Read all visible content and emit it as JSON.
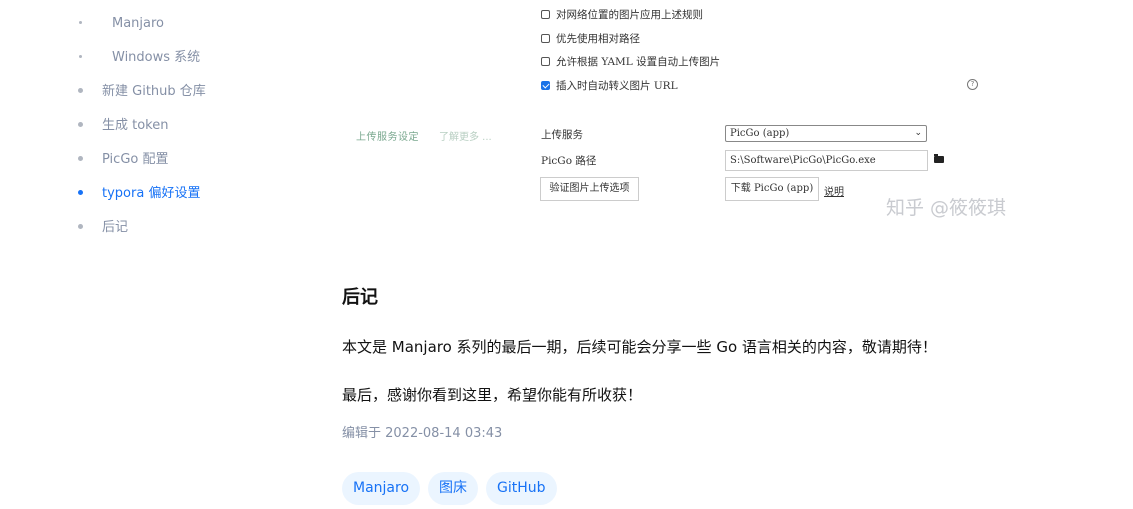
{
  "toc": {
    "items": [
      {
        "label": "Manjaro",
        "level": "sub",
        "active": false
      },
      {
        "label": "Windows 系统",
        "level": "sub",
        "active": false
      },
      {
        "label": "新建 Github 仓库",
        "level": "main",
        "active": false
      },
      {
        "label": "生成 token",
        "level": "main",
        "active": false
      },
      {
        "label": "PicGo 配置",
        "level": "main",
        "active": false
      },
      {
        "label": "typora 偏好设置",
        "level": "main",
        "active": true
      },
      {
        "label": "后记",
        "level": "main",
        "active": false
      }
    ]
  },
  "settings_shot": {
    "checkboxes": [
      {
        "label": "对网络位置的图片应用上述规则",
        "checked": false
      },
      {
        "label": "优先使用相对路径",
        "checked": false
      },
      {
        "label": "允许根据 YAML 设置自动上传图片",
        "checked": false
      },
      {
        "label": "插入时自动转义图片 URL",
        "checked": true
      }
    ],
    "help_icon": "?",
    "upload_section_title": "上传服务设定",
    "learn_more": "了解更多 ...",
    "upload_service_label": "上传服务",
    "upload_service_value": "PicGo (app)",
    "picgo_path_label": "PicGo 路径",
    "picgo_path_value": "S:\\Software\\PicGo\\PicGo.exe",
    "verify_button": "验证图片上传选项",
    "download_button": "下载 PicGo (app)",
    "explain_link": "说明",
    "watermark": "知乎 @筱筱琪"
  },
  "article": {
    "heading": "后记",
    "paragraph1": "本文是 Manjaro 系列的最后一期，后续可能会分享一些 Go 语言相关的内容，敬请期待！",
    "paragraph2": "最后，感谢你看到这里，希望你能有所收获！",
    "edit_time": "编辑于 2022-08-14 03:43",
    "tags": [
      "Manjaro",
      "图床",
      "GitHub"
    ]
  },
  "colors": {
    "accent": "#1772f6",
    "muted": "#8590a6",
    "tag_bg": "#ebf5ff"
  }
}
